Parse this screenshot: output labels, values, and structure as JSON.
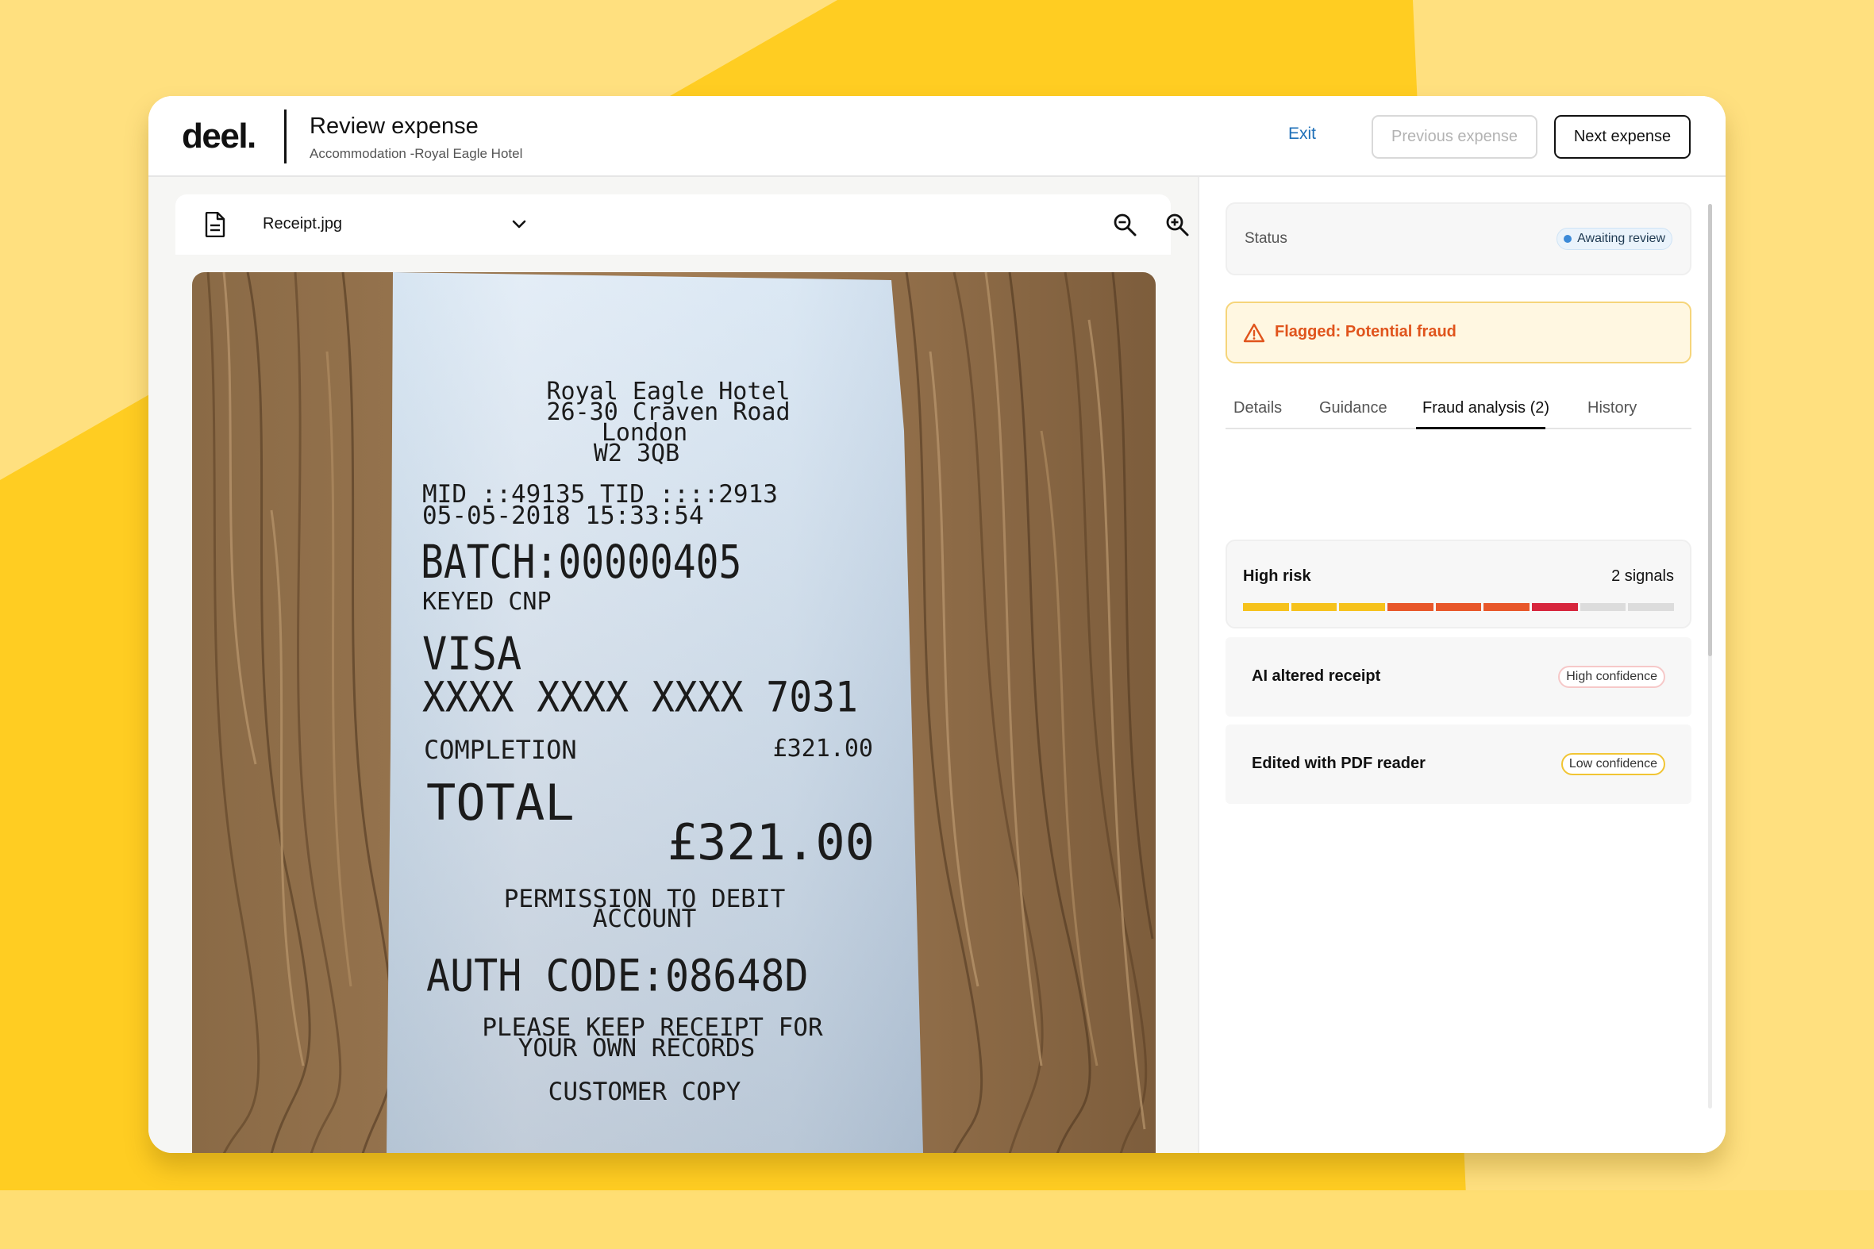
{
  "app": {
    "logo": "deel.",
    "title": "Review expense",
    "subtitle": "Accommodation -Royal Eagle Hotel"
  },
  "header": {
    "exit_label": "Exit",
    "prev_label": "Previous expense",
    "next_label": "Next expense"
  },
  "viewer": {
    "file_name": "Receipt.jpg",
    "tools": [
      "zoom-out-icon",
      "zoom-in-icon",
      "rotate-icon",
      "download-icon"
    ]
  },
  "receipt": {
    "lines": [
      "Royal Eagle Hotel",
      "26-30 Craven Road",
      "London",
      "W2 3QB",
      "MID ::49135 TID ::::2913",
      "05-05-2018        15:33:54",
      "BATCH:00000405",
      "KEYED      CNP",
      "VISA",
      "XXXX XXXX XXXX 7031",
      "COMPLETION",
      "£321.00",
      "TOTAL",
      "£321.00",
      "PERMISSION TO DEBIT",
      "ACCOUNT",
      "AUTH CODE:08648D",
      "PLEASE KEEP RECEIPT FOR",
      "YOUR OWN RECORDS",
      "CUSTOMER COPY"
    ]
  },
  "panel": {
    "status_label": "Status",
    "status_value": "Awaiting review",
    "alert_text": "Flagged: Potential fraud",
    "tabs": [
      "Details",
      "Guidance",
      "Fraud analysis (2)",
      "History"
    ],
    "active_tab": "Fraud analysis (2)",
    "risk": {
      "title": "High risk",
      "count": "2 signals",
      "segments": 9,
      "active_segments": 7
    },
    "signals": [
      {
        "name": "AI altered receipt",
        "confidence": "High confidence"
      },
      {
        "name": "Edited with PDF reader",
        "confidence": "Low confidence"
      }
    ]
  },
  "colors": {
    "background": "#FFCD22",
    "accent_link": "#1d6fb8",
    "alert_text": "#e0541c",
    "risk_yellow": "#f6c21c",
    "risk_orange": "#e8572a",
    "risk_red": "#d7263d",
    "risk_empty": "#dcdcdc"
  }
}
